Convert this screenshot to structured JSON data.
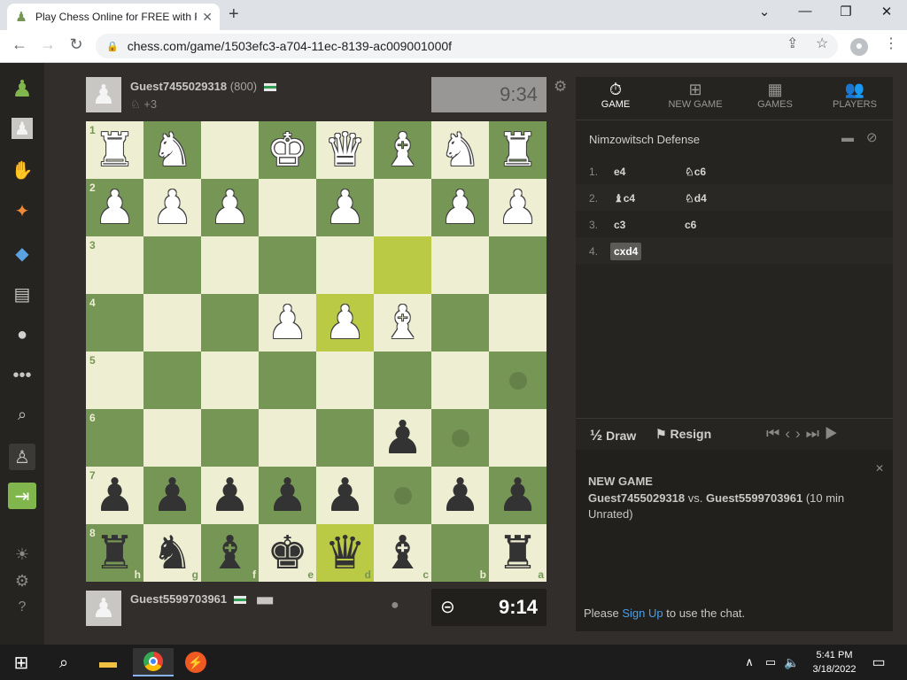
{
  "browser": {
    "tab_title": "Play Chess Online for FREE with F",
    "url": "chess.com/game/1503efc3-a704-11ec-8139-ac009001000f",
    "new_tab": "+",
    "controls": {
      "minimize": "—",
      "restore": "❐",
      "close": "✕",
      "tab_menu": "⌄"
    }
  },
  "top_player": {
    "name": "Guest7455029318",
    "rating": "(800)",
    "captured": "♘",
    "material": "+3",
    "clock": "9:34",
    "flag": "white-green-flag"
  },
  "bottom_player": {
    "name": "Guest5599703961",
    "strength": "▮▮▮▮▮",
    "clock": "9:14",
    "flag": "white-green-flag"
  },
  "board": {
    "ranks": [
      "1",
      "2",
      "3",
      "4",
      "5",
      "6",
      "7",
      "8"
    ],
    "files": [
      "h",
      "g",
      "f",
      "e",
      "d",
      "c",
      "b",
      "a"
    ],
    "squares": [
      [
        "wR",
        "wN",
        "",
        "wK",
        "wQ",
        "wB",
        "wN",
        "wR"
      ],
      [
        "wP",
        "wP",
        "wP",
        "",
        "wP",
        "",
        "wP",
        "wP"
      ],
      [
        "",
        "",
        "",
        "",
        "",
        "",
        "",
        ""
      ],
      [
        "",
        "",
        "",
        "wP",
        "wP",
        "wB",
        "",
        ""
      ],
      [
        "",
        "",
        "",
        "",
        "",
        "",
        "",
        ""
      ],
      [
        "",
        "",
        "",
        "",
        "",
        "bP",
        "",
        ""
      ],
      [
        "bP",
        "bP",
        "bP",
        "bP",
        "bP",
        "",
        "bP",
        "bP"
      ],
      [
        "bR",
        "bN",
        "bB",
        "bK",
        "bQ",
        "bB",
        "",
        "bR"
      ]
    ],
    "highlights": [
      [
        2,
        5
      ],
      [
        3,
        4
      ],
      [
        7,
        4
      ]
    ],
    "move_dots": [
      [
        4,
        7
      ],
      [
        5,
        6
      ],
      [
        6,
        5
      ]
    ],
    "colors": {
      "light": "#eeeed2",
      "dark": "#769656",
      "highlight": "#baca44"
    }
  },
  "panel": {
    "tabs": [
      {
        "label": "GAME",
        "icon": "stopwatch-icon",
        "glyph": "⏱"
      },
      {
        "label": "NEW GAME",
        "icon": "plus-square-icon",
        "glyph": "⊞"
      },
      {
        "label": "GAMES",
        "icon": "board-grid-icon",
        "glyph": "▦"
      },
      {
        "label": "PLAYERS",
        "icon": "players-icon",
        "glyph": "👥"
      }
    ],
    "opening": "Nimzowitsch Defense",
    "moves": [
      {
        "num": "1.",
        "white": "e4",
        "black": "♘c6"
      },
      {
        "num": "2.",
        "white": "♝c4",
        "black": "♘d4"
      },
      {
        "num": "3.",
        "white": "c3",
        "black": "c6"
      },
      {
        "num": "4.",
        "white": "cxd4",
        "black": ""
      }
    ],
    "draw_label": "Draw",
    "half": "½",
    "resign_label": "Resign",
    "chat": {
      "header": "NEW GAME",
      "white_name": "Guest7455029318",
      "vs": "vs.",
      "black_name": "Guest5599703961",
      "details": "(10 min Unrated)",
      "please": "Please",
      "sign_up": "Sign Up",
      "rest": "to use the chat."
    }
  },
  "taskbar": {
    "time": "5:41 PM",
    "date": "3/18/2022"
  }
}
